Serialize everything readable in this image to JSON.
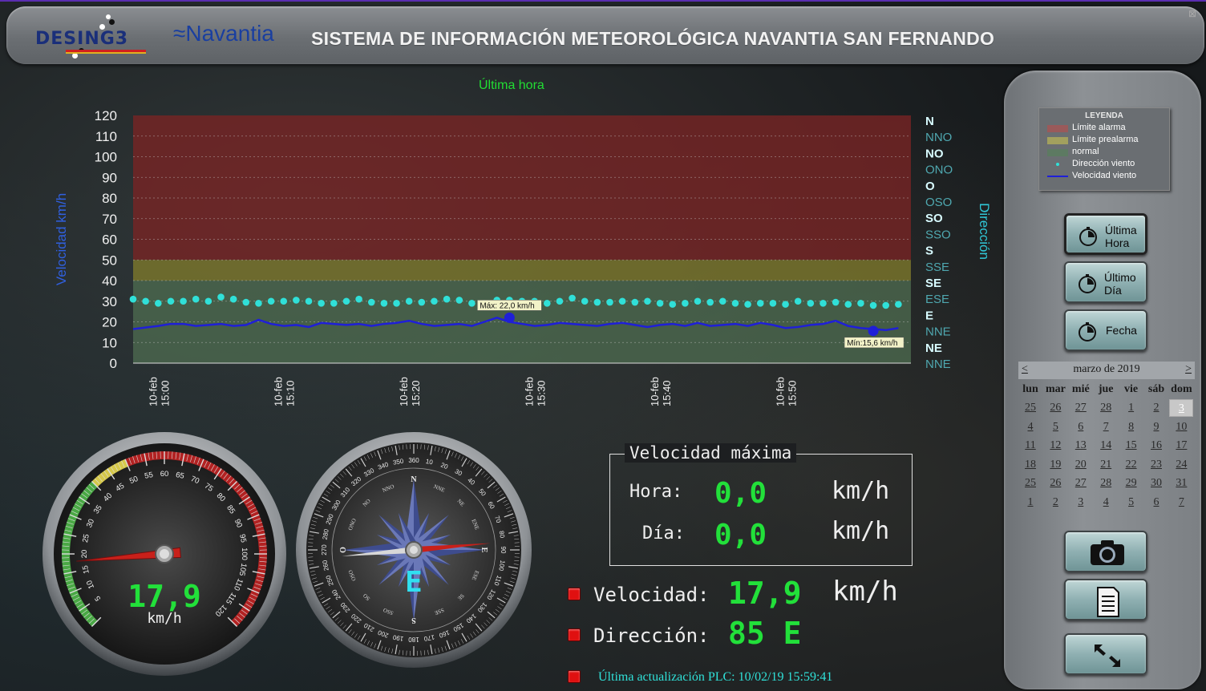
{
  "header": {
    "logo_left": "DESING3",
    "logo_right": "≈Navantia",
    "title": "SISTEMA DE INFORMACIÓN METEOROLÓGICA NAVANTIA SAN FERNANDO"
  },
  "chart_data": {
    "type": "line",
    "title": "Última hora",
    "ylabel": "Velocidad km/h",
    "y2label": "Dirección",
    "ylim": [
      0,
      120
    ],
    "yticks": [
      "0",
      "10",
      "20",
      "30",
      "40",
      "50",
      "60",
      "70",
      "80",
      "90",
      "100",
      "110",
      "120"
    ],
    "direction_ticks": [
      "N",
      "NNO",
      "NO",
      "ONO",
      "O",
      "OSO",
      "SO",
      "SSO",
      "S",
      "SSE",
      "SE",
      "ESE",
      "E",
      "NNE",
      "NE",
      "NNE"
    ],
    "x_ticks": [
      {
        "date": "10-feb",
        "time": "15:00"
      },
      {
        "date": "10-feb",
        "time": "15:10"
      },
      {
        "date": "10-feb",
        "time": "15:20"
      },
      {
        "date": "10-feb",
        "time": "15:30"
      },
      {
        "date": "10-feb",
        "time": "15:40"
      },
      {
        "date": "10-feb",
        "time": "15:50"
      }
    ],
    "x_range_minutes": [
      -2,
      60
    ],
    "bands": [
      {
        "name": "Límite alarma",
        "from": 50,
        "to": 120,
        "color": "#7a2424"
      },
      {
        "name": "Límite prealarma",
        "from": 40,
        "to": 50,
        "color": "#7f7a2c"
      },
      {
        "name": "normal",
        "from": 0,
        "to": 40,
        "color": "#4d6a50"
      }
    ],
    "series": [
      {
        "name": "Velocidad viento",
        "color": "#1f1fd8",
        "x": [
          -2,
          0,
          1,
          2,
          3,
          4,
          5,
          6,
          7,
          8,
          9,
          10,
          11,
          12,
          13,
          14,
          15,
          16,
          17,
          18,
          19,
          20,
          21,
          22,
          23,
          24,
          25,
          26,
          27,
          28,
          29,
          30,
          31,
          32,
          33,
          34,
          35,
          36,
          37,
          38,
          39,
          40,
          41,
          42,
          43,
          44,
          45,
          46,
          47,
          48,
          49,
          50,
          51,
          52,
          53,
          54,
          55,
          56,
          57,
          58,
          59
        ],
        "y": [
          16.5,
          18,
          19,
          19,
          18,
          18.5,
          19,
          18,
          18.5,
          21,
          19,
          18,
          18.5,
          17.5,
          19.5,
          19,
          18.5,
          19,
          18,
          19,
          19.5,
          20.5,
          19,
          18,
          18.5,
          19,
          18,
          20,
          22,
          20,
          19,
          18,
          18.5,
          19.5,
          19,
          18.5,
          18,
          19,
          19.5,
          18.5,
          17.5,
          18.5,
          19,
          18,
          19.5,
          18,
          18.5,
          19,
          18,
          19.5,
          18.5,
          17,
          17.5,
          18.5,
          19,
          20.5,
          18,
          17,
          16.5,
          16,
          17
        ]
      },
      {
        "name": "Dirección viento",
        "color": "#30e0d8",
        "x": [
          -2,
          -1,
          0,
          1,
          2,
          3,
          4,
          5,
          6,
          7,
          8,
          9,
          10,
          11,
          12,
          13,
          14,
          15,
          16,
          17,
          18,
          19,
          20,
          21,
          22,
          23,
          24,
          25,
          26,
          27,
          28,
          29,
          30,
          31,
          32,
          33,
          34,
          35,
          36,
          37,
          38,
          39,
          40,
          41,
          42,
          43,
          44,
          45,
          46,
          47,
          48,
          49,
          50,
          51,
          52,
          53,
          54,
          55,
          56,
          57,
          58,
          59
        ],
        "y": [
          31,
          30,
          29,
          30,
          30,
          31,
          30,
          32,
          31,
          29.5,
          29,
          30,
          30,
          30.5,
          30,
          29,
          29,
          30,
          31,
          29.5,
          29,
          29,
          30,
          29.5,
          30,
          31,
          30.5,
          29,
          29,
          30.5,
          30.5,
          30,
          30,
          29,
          30,
          31.5,
          30,
          29.5,
          29.5,
          30,
          29.5,
          30,
          29,
          28.5,
          29,
          30,
          29.5,
          30,
          29,
          28.5,
          29,
          29,
          28.5,
          30,
          29,
          29,
          29.5,
          28.5,
          29,
          28,
          28,
          28.5
        ]
      }
    ],
    "annotations": [
      {
        "text": "Máx: 22,0 km/h",
        "x": 28,
        "y": 22
      },
      {
        "text": "Mín:15,6 km/h",
        "x": 57,
        "y": 15.6
      }
    ]
  },
  "legend": {
    "title": "LEYENDA",
    "items": [
      {
        "label": "Límite alarma",
        "color": "#9a5a5a",
        "kind": "band"
      },
      {
        "label": "Límite prealarma",
        "color": "#a2a05e",
        "kind": "band"
      },
      {
        "label": "normal",
        "color": "#5d7a62",
        "kind": "band"
      },
      {
        "label": "Dirección viento",
        "color": "#30e0d8",
        "kind": "dot"
      },
      {
        "label": "Velocidad viento",
        "color": "#1f1fd8",
        "kind": "line"
      }
    ]
  },
  "buttons": {
    "ultima_hora": "Última\nHora",
    "ultimo_dia": "Último\nDía",
    "fecha": "Fecha"
  },
  "calendar": {
    "prev": "<",
    "next": ">",
    "month": "marzo de 2019",
    "dows": [
      "lun",
      "mar",
      "mié",
      "jue",
      "vie",
      "sáb",
      "dom"
    ],
    "weeks": [
      [
        "25",
        "26",
        "27",
        "28",
        "1",
        "2",
        "3"
      ],
      [
        "4",
        "5",
        "6",
        "7",
        "8",
        "9",
        "10"
      ],
      [
        "11",
        "12",
        "13",
        "14",
        "15",
        "16",
        "17"
      ],
      [
        "18",
        "19",
        "20",
        "21",
        "22",
        "23",
        "24"
      ],
      [
        "25",
        "26",
        "27",
        "28",
        "29",
        "30",
        "31"
      ],
      [
        "1",
        "2",
        "3",
        "4",
        "5",
        "6",
        "7"
      ]
    ],
    "selected": "3"
  },
  "speed_gauge": {
    "value": 17.9,
    "value_text": "17,9",
    "unit": "km/h",
    "min": 0,
    "max": 120,
    "tick_labels": [
      "5",
      "10",
      "15",
      "20",
      "25",
      "30",
      "35",
      "40",
      "45",
      "50",
      "55",
      "60",
      "65",
      "70",
      "75",
      "80",
      "85",
      "90",
      "95",
      "100",
      "105",
      "110",
      "115",
      "120"
    ]
  },
  "compass": {
    "heading_deg": 85,
    "center_label": "E",
    "points": [
      "N",
      "NNE",
      "NE",
      "ENE",
      "E",
      "ESE",
      "SE",
      "SSE",
      "S",
      "SSO",
      "SO",
      "OSO",
      "O",
      "ONO",
      "NO",
      "NNO"
    ],
    "degree_labels": [
      "360",
      "10",
      "20",
      "30",
      "40",
      "50",
      "60",
      "70",
      "80",
      "90",
      "100",
      "110",
      "120",
      "130",
      "140",
      "150",
      "160",
      "170",
      "180",
      "190",
      "200",
      "210",
      "220",
      "230",
      "240",
      "250",
      "260",
      "270",
      "280",
      "290",
      "300",
      "310",
      "320",
      "330",
      "340",
      "350"
    ]
  },
  "max_speed": {
    "title": "Velocidad máxima",
    "hour_label": "Hora:",
    "hour_value": "0,0",
    "hour_unit": "km/h",
    "day_label": "Día:",
    "day_value": "0,0",
    "day_unit": "km/h"
  },
  "current": {
    "speed_label": "Velocidad:",
    "speed_value": "17,9",
    "speed_unit": "km/h",
    "dir_label": "Dirección:",
    "dir_value": "85 E",
    "update_text": "Última actualización PLC: 10/02/19 15:59:41"
  },
  "colors": {
    "lcd_green": "#22e03a",
    "led_red": "#e01010",
    "update_text": "#30e0d8"
  }
}
